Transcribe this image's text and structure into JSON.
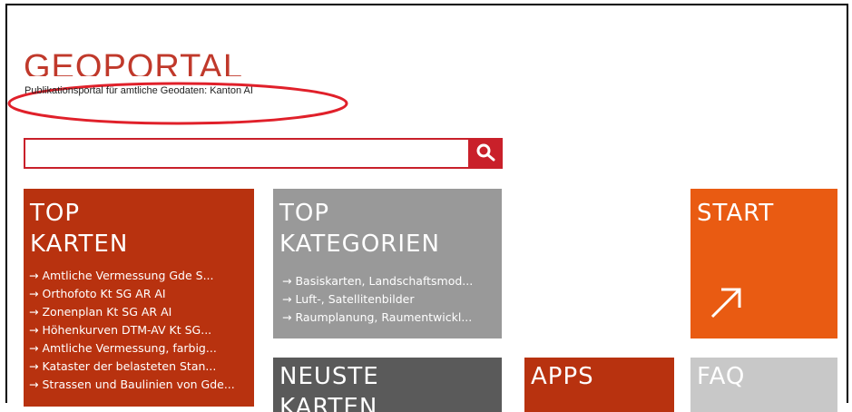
{
  "header": {
    "logo_text": "GEOPORTAL",
    "subtitle": "Publikationsportal für amtliche Geodaten: Kanton AI"
  },
  "search": {
    "value": "",
    "placeholder": "",
    "icon": "search-icon"
  },
  "tiles": {
    "top_karten": {
      "title_line1": "TOP",
      "title_line2": "KARTEN",
      "items": [
        "Amtliche Vermessung Gde S...",
        "Orthofoto Kt SG AR AI",
        "Zonenplan Kt SG AR AI",
        "Höhenkurven DTM-AV Kt SG...",
        "Amtliche Vermessung, farbig...",
        "Kataster der belasteten Stan...",
        "Strassen und Baulinien von Gde..."
      ]
    },
    "top_kategorien": {
      "title_line1": "TOP",
      "title_line2": "KATEGORIEN",
      "items": [
        "Basiskarten, Landschaftsmod...",
        "Luft-, Satellitenbilder",
        "Raumplanung, Raumentwickl..."
      ]
    },
    "start": {
      "title": "START",
      "icon": "arrow-up-right-icon"
    },
    "neuste_karten": {
      "title_line1": "NEUSTE",
      "title_line2": "KARTEN"
    },
    "apps": {
      "title": "APPS"
    },
    "faq": {
      "title": "FAQ"
    }
  },
  "colors": {
    "brand_red": "#c9202a",
    "tile_dark_red": "#b8320f",
    "tile_orange": "#e95b12",
    "tile_grey": "#999999",
    "tile_dark_grey": "#5a5a5a",
    "tile_light_grey": "#c8c8c8",
    "annotation_ellipse": "#e0202a"
  }
}
